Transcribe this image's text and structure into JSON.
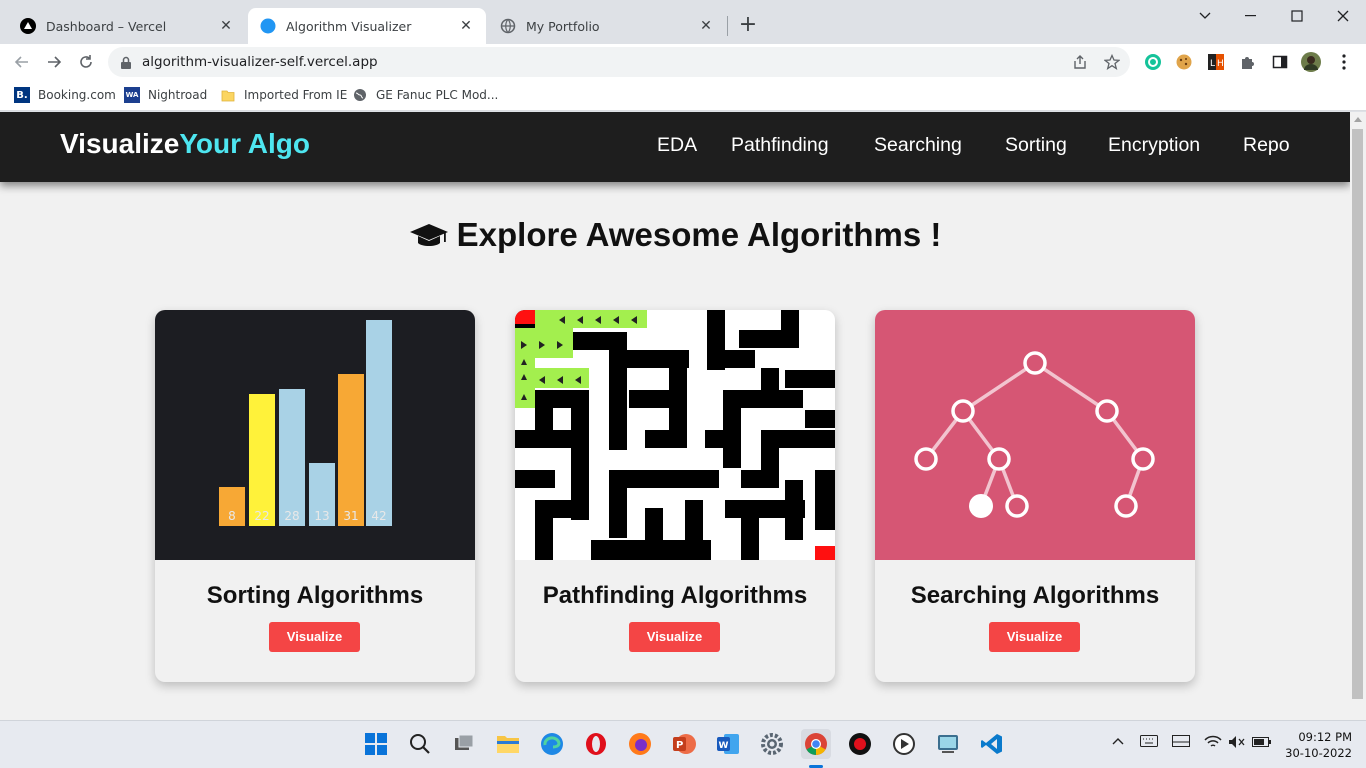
{
  "browser": {
    "tabs": [
      {
        "title": "Dashboard – Vercel",
        "favicon": "vercel-icon",
        "active": false
      },
      {
        "title": "Algorithm Visualizer",
        "favicon": "globe-blue-icon",
        "active": true
      },
      {
        "title": "My Portfolio",
        "favicon": "globe-icon",
        "active": false
      }
    ],
    "new_tab": "+",
    "url": "algorithm-visualizer-self.vercel.app",
    "bookmarks": [
      {
        "label": "Booking.com",
        "icon_text": "B."
      },
      {
        "label": "Nightroad",
        "icon_text": "WA"
      },
      {
        "label": "Imported From IE",
        "icon_text": ""
      },
      {
        "label": "GE Fanuc PLC Mod...",
        "icon_text": ""
      }
    ]
  },
  "site": {
    "logo_main": "Visualize",
    "logo_accent": "Your Algo",
    "accent_color": "#4ee6f0",
    "nav": [
      "EDA",
      "Pathfinding",
      "Searching",
      "Sorting",
      "Encryption",
      "Repo"
    ],
    "heading": "Explore Awesome Algorithms !",
    "cards": [
      {
        "title": "Sorting Algorithms",
        "button": "Visualize",
        "bar_labels": [
          "8",
          "22",
          "28",
          "13",
          "31",
          "42"
        ]
      },
      {
        "title": "Pathfinding Algorithms",
        "button": "Visualize"
      },
      {
        "title": "Searching Algorithms",
        "button": "Visualize"
      }
    ],
    "button_color": "#f44545"
  },
  "taskbar": {
    "time": "09:12 PM",
    "date": "30-10-2022"
  }
}
